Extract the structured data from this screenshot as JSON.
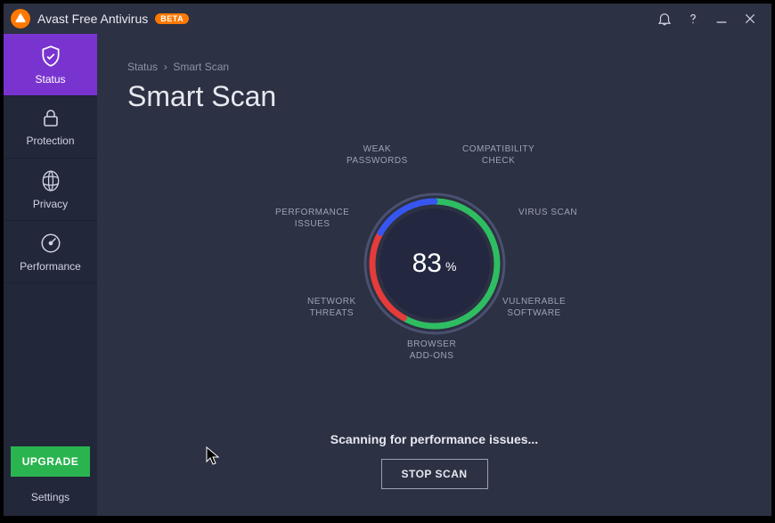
{
  "app": {
    "name": "Avast Free Antivirus",
    "beta_label": "BETA"
  },
  "sidebar": {
    "items": [
      {
        "label": "Status"
      },
      {
        "label": "Protection"
      },
      {
        "label": "Privacy"
      },
      {
        "label": "Performance"
      }
    ],
    "upgrade_label": "UPGRADE",
    "settings_label": "Settings"
  },
  "breadcrumb": {
    "parent": "Status",
    "current": "Smart Scan"
  },
  "page": {
    "title": "Smart Scan"
  },
  "dial": {
    "percent": "83",
    "unit": "%",
    "labels": {
      "compatibility": "COMPATIBILITY\nCHECK",
      "virus": "VIRUS SCAN",
      "vulnerable": "VULNERABLE\nSOFTWARE",
      "browser": "BROWSER\nADD-ONS",
      "network": "NETWORK\nTHREATS",
      "performance": "PERFORMANCE\nISSUES",
      "weak": "WEAK\nPASSWORDS"
    }
  },
  "status_text": "Scanning for performance issues...",
  "stop_label": "STOP SCAN",
  "colors": {
    "accent": "#7934d0",
    "green": "#2ab450",
    "ring_green": "#2fbd62",
    "ring_blue": "#3756f0",
    "ring_red": "#e43b3b",
    "ring_track": "#4a5170"
  }
}
